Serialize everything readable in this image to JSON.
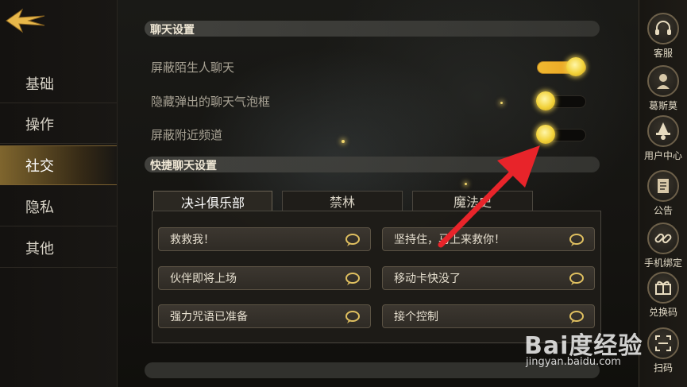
{
  "nav": {
    "items": [
      {
        "label": "基础"
      },
      {
        "label": "操作"
      },
      {
        "label": "社交"
      },
      {
        "label": "隐私"
      },
      {
        "label": "其他"
      }
    ],
    "active_index": 2
  },
  "chat": {
    "title": "聊天设置",
    "rows": [
      {
        "label": "屏蔽陌生人聊天",
        "on": true
      },
      {
        "label": "隐藏弹出的聊天气泡框",
        "on": false
      },
      {
        "label": "屏蔽附近频道",
        "on": false
      }
    ]
  },
  "quick": {
    "title": "快捷聊天设置",
    "tabs": [
      "决斗俱乐部",
      "禁林",
      "魔法史"
    ],
    "active_tab": 0,
    "phrases": [
      "救救我！",
      "坚持住，马上来救你！",
      "伙伴即将上场",
      "移动卡快没了",
      "强力咒语已准备",
      "接个控制"
    ]
  },
  "sidebar": {
    "items": [
      {
        "label": "客服",
        "icon": "headset-icon"
      },
      {
        "label": "葛斯莫",
        "icon": "character-icon"
      },
      {
        "label": "用户中心",
        "icon": "wizard-icon"
      },
      {
        "label": "公告",
        "icon": "scroll-icon"
      },
      {
        "label": "手机绑定",
        "icon": "link-icon"
      },
      {
        "label": "兑换码",
        "icon": "gift-icon"
      },
      {
        "label": "扫码",
        "icon": "scan-icon"
      }
    ]
  },
  "watermark": {
    "logo": "Bai度经验",
    "url": "jingyan.baidu.com"
  },
  "colors": {
    "accent": "#f0b830",
    "arrow": "#e8242a"
  }
}
